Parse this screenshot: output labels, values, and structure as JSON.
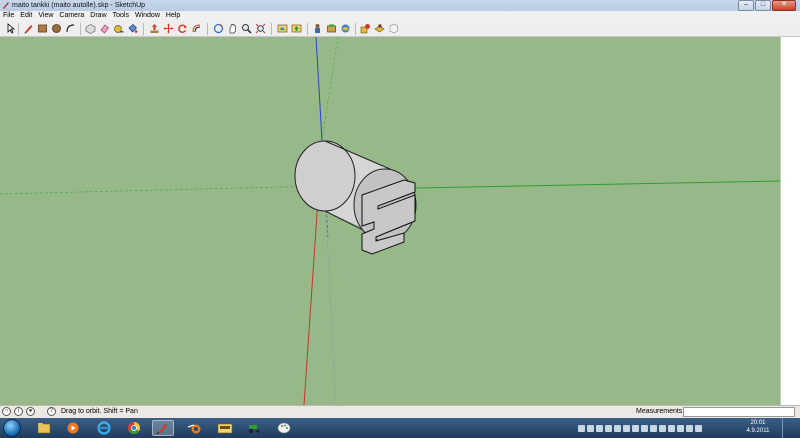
{
  "window": {
    "title": "maito tankki (maito autolle).skp - SketchUp",
    "minimize": "–",
    "maximize": "□",
    "close": "✕"
  },
  "menu": [
    "File",
    "Edit",
    "View",
    "Camera",
    "Draw",
    "Tools",
    "Window",
    "Help"
  ],
  "toolbar": {
    "tools": [
      "select-tool-icon",
      "pencil-line-tool-icon",
      "rectangle-tool-icon",
      "circle-tool-icon",
      "arc-tool-icon",
      "make-component-icon",
      "eraser-icon",
      "tape-measure-icon",
      "paint-bucket-icon",
      "push-pull-icon",
      "move-icon",
      "rotate-icon",
      "offset-icon",
      "orbit-icon",
      "pan-icon",
      "zoom-icon",
      "zoom-extents-icon",
      "get-models-icon",
      "share-model-icon",
      "component-icon",
      "extension-icon",
      "scene-icon",
      "style-icon",
      "layer-icon"
    ]
  },
  "viewport": {
    "background": "#97b98a",
    "axis_colors": {
      "red": "#c0392b",
      "green": "#2e9e2e",
      "blue": "#2a42c8"
    }
  },
  "status": {
    "hint": "Drag to orbit.  Shift = Pan",
    "measurements_label": "Measurements",
    "measurements_value": ""
  },
  "taskbar": {
    "apps": [
      "explorer-icon",
      "media-player-icon",
      "internet-explorer-icon",
      "chrome-icon",
      "sketchup-icon",
      "blender-icon",
      "folder-icon",
      "tractor-game-icon",
      "paint-icon"
    ],
    "clock_time": "20:01",
    "clock_date": "4.9.2011"
  }
}
